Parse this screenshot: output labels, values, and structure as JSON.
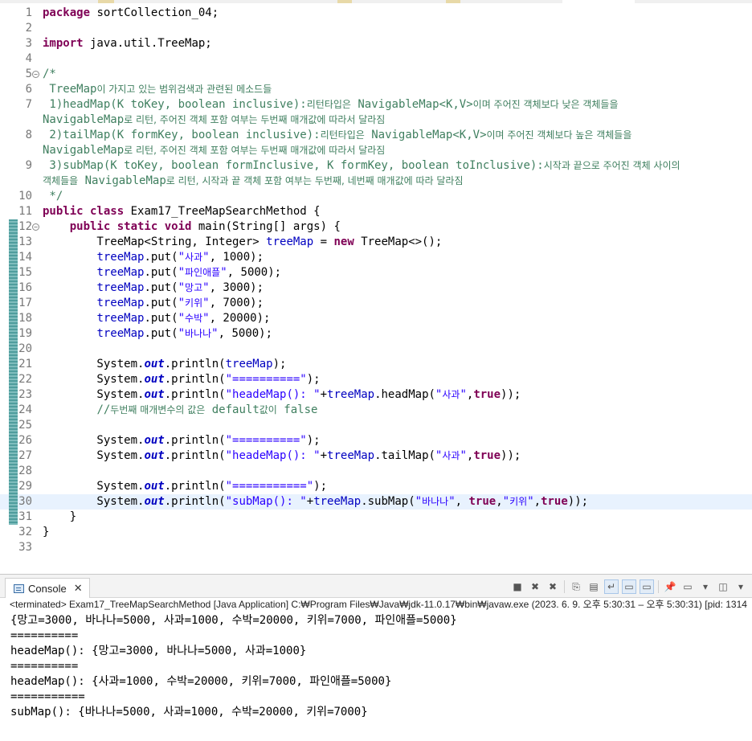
{
  "editor": {
    "lines": [
      {
        "n": "1",
        "html": "<span class=\"kw\">package</span> sortCollection_04;"
      },
      {
        "n": "2",
        "html": ""
      },
      {
        "n": "3",
        "html": "<span class=\"kw\">import</span> java.util.TreeMap;"
      },
      {
        "n": "4",
        "html": ""
      },
      {
        "n": "5",
        "fold": true,
        "html": "<span class=\"cmt\">/*</span>"
      },
      {
        "n": "6",
        "html": "<span class=\"cmt\"> TreeMap<span class=\"ko\">이 가지고 있는 범위검색과 관련된 메소드들</span></span>"
      },
      {
        "n": "7",
        "html": "<span class=\"cmt\"> 1)headMap(K toKey, boolean inclusive):<span class=\"ko\">리턴타입은</span> NavigableMap&lt;K,V&gt;<span class=\"ko\">이며 주어진 객체보다 낮은 객체들을</span></span>"
      },
      {
        "n": "",
        "html": "<span class=\"cmt\">NavigableMap<span class=\"ko\">로 리턴, 주어진 객체 포함 여부는 두번째 매개값에 따라서 달라짐</span></span>"
      },
      {
        "n": "8",
        "html": "<span class=\"cmt\"> 2)tailMap(K formKey, boolean inclusive):<span class=\"ko\">리턴타입은</span> NavigableMap&lt;K,V&gt;<span class=\"ko\">이며 주어진 객체보다 높은 객체들을</span></span>"
      },
      {
        "n": "",
        "html": "<span class=\"cmt\">NavigableMap<span class=\"ko\">로 리턴, 주어진 객체 포함 여부는 두번째 매개값에 따라서 달라짐</span></span>"
      },
      {
        "n": "9",
        "html": "<span class=\"cmt\"> 3)subMap(K toKey, boolean formInclusive, K formKey, boolean toInclusive):<span class=\"ko\">시작과 끝으로 주어진 객체 사이의</span></span>"
      },
      {
        "n": "",
        "html": "<span class=\"cmt\"><span class=\"ko\">객체들을</span> NavigableMap<span class=\"ko\">로 리턴, 시작과 끝 객체 포함 여부는 두번째, 네번째 매개값에 따라 달라짐</span></span>"
      },
      {
        "n": "10",
        "html": "<span class=\"cmt\"> */</span>"
      },
      {
        "n": "11",
        "html": "<span class=\"kw\">public class</span> Exam17_TreeMapSearchMethod {"
      },
      {
        "n": "12",
        "fold": true,
        "changed": true,
        "html": "    <span class=\"kw\">public static void</span> main(String[] args) {"
      },
      {
        "n": "13",
        "changed": true,
        "html": "        TreeMap&lt;String, Integer&gt; <span class=\"fld\">treeMap</span> = <span class=\"kw\">new</span> TreeMap&lt;&gt;();"
      },
      {
        "n": "14",
        "changed": true,
        "html": "        <span class=\"fld\">treeMap</span>.put(<span class=\"str\">\"<span class=\"ko\">사과</span>\"</span>, 1000);"
      },
      {
        "n": "15",
        "changed": true,
        "html": "        <span class=\"fld\">treeMap</span>.put(<span class=\"str\">\"<span class=\"ko\">파인애플</span>\"</span>, 5000);"
      },
      {
        "n": "16",
        "changed": true,
        "html": "        <span class=\"fld\">treeMap</span>.put(<span class=\"str\">\"<span class=\"ko\">망고</span>\"</span>, 3000);"
      },
      {
        "n": "17",
        "changed": true,
        "html": "        <span class=\"fld\">treeMap</span>.put(<span class=\"str\">\"<span class=\"ko\">키위</span>\"</span>, 7000);"
      },
      {
        "n": "18",
        "changed": true,
        "html": "        <span class=\"fld\">treeMap</span>.put(<span class=\"str\">\"<span class=\"ko\">수박</span>\"</span>, 20000);"
      },
      {
        "n": "19",
        "changed": true,
        "html": "        <span class=\"fld\">treeMap</span>.put(<span class=\"str\">\"<span class=\"ko\">바나나</span>\"</span>, 5000);"
      },
      {
        "n": "20",
        "changed": true,
        "html": ""
      },
      {
        "n": "21",
        "changed": true,
        "html": "        System.<span class=\"sfld\">out</span>.println(<span class=\"fld\">treeMap</span>);"
      },
      {
        "n": "22",
        "changed": true,
        "html": "        System.<span class=\"sfld\">out</span>.println(<span class=\"str\">\"==========\"</span>);"
      },
      {
        "n": "23",
        "changed": true,
        "html": "        System.<span class=\"sfld\">out</span>.println(<span class=\"str\">\"headeMap(): \"</span>+<span class=\"fld\">treeMap</span>.headMap(<span class=\"str\">\"<span class=\"ko\">사과</span>\"</span>,<span class=\"kw\">true</span>));"
      },
      {
        "n": "24",
        "changed": true,
        "html": "        <span class=\"cmt\">//<span class=\"ko\">두번째 매개변수의 값은</span> default<span class=\"ko\">값이</span> false</span>"
      },
      {
        "n": "25",
        "changed": true,
        "html": ""
      },
      {
        "n": "26",
        "changed": true,
        "html": "        System.<span class=\"sfld\">out</span>.println(<span class=\"str\">\"==========\"</span>);"
      },
      {
        "n": "27",
        "changed": true,
        "html": "        System.<span class=\"sfld\">out</span>.println(<span class=\"str\">\"headeMap(): \"</span>+<span class=\"fld\">treeMap</span>.tailMap(<span class=\"str\">\"<span class=\"ko\">사과</span>\"</span>,<span class=\"kw\">true</span>));"
      },
      {
        "n": "28",
        "changed": true,
        "html": ""
      },
      {
        "n": "29",
        "changed": true,
        "html": "        System.<span class=\"sfld\">out</span>.println(<span class=\"str\">\"===========\"</span>);"
      },
      {
        "n": "30",
        "changed": true,
        "highlight": true,
        "html": "        System.<span class=\"sfld\">out</span>.println(<span class=\"str\">\"subMap(): \"</span>+<span class=\"fld\">treeMap</span>.subMap(<span class=\"str\">\"<span class=\"ko\">바나나</span>\"</span>, <span class=\"kw\">true</span>,<span class=\"str\">\"<span class=\"ko\">키위</span>\"</span>,<span class=\"kw\">true</span>));"
      },
      {
        "n": "31",
        "changed": true,
        "html": "    }"
      },
      {
        "n": "32",
        "html": "}"
      },
      {
        "n": "33",
        "html": ""
      }
    ]
  },
  "console": {
    "tab_label": "Console",
    "tab_close": "✕",
    "status": "<terminated> Exam17_TreeMapSearchMethod [Java Application] C:₩Program Files₩Java₩jdk-11.0.17₩bin₩javaw.exe  (2023. 6. 9. 오후 5:30:31 – 오후 5:30:31) [pid: 1314",
    "output": [
      "{망고=3000, 바나나=5000, 사과=1000, 수박=20000, 키위=7000, 파인애플=5000}",
      "==========",
      "headeMap(): {망고=3000, 바나나=5000, 사과=1000}",
      "==========",
      "headeMap(): {사과=1000, 수박=20000, 키위=7000, 파인애플=5000}",
      "===========",
      "subMap(): {바나나=5000, 사과=1000, 수박=20000, 키위=7000}"
    ],
    "toolbar": [
      {
        "name": "terminate-icon",
        "glyph": "■"
      },
      {
        "name": "remove-launch-icon",
        "glyph": "✖"
      },
      {
        "name": "remove-all-terminated-icon",
        "glyph": "✖"
      },
      {
        "name": "sep"
      },
      {
        "name": "copy-icon",
        "glyph": "⎘"
      },
      {
        "name": "scroll-lock-icon",
        "glyph": "▤"
      },
      {
        "name": "word-wrap-icon",
        "glyph": "↵",
        "sel": true
      },
      {
        "name": "show-stdout-icon",
        "glyph": "▭",
        "sel": true
      },
      {
        "name": "show-stderr-icon",
        "glyph": "▭",
        "sel": true
      },
      {
        "name": "sep"
      },
      {
        "name": "pin-console-icon",
        "glyph": "📌"
      },
      {
        "name": "display-console-icon",
        "glyph": "▭"
      },
      {
        "name": "dropdown-icon",
        "glyph": "▾"
      },
      {
        "name": "new-console-icon",
        "glyph": "◫"
      },
      {
        "name": "dropdown-icon-2",
        "glyph": "▾"
      }
    ]
  }
}
